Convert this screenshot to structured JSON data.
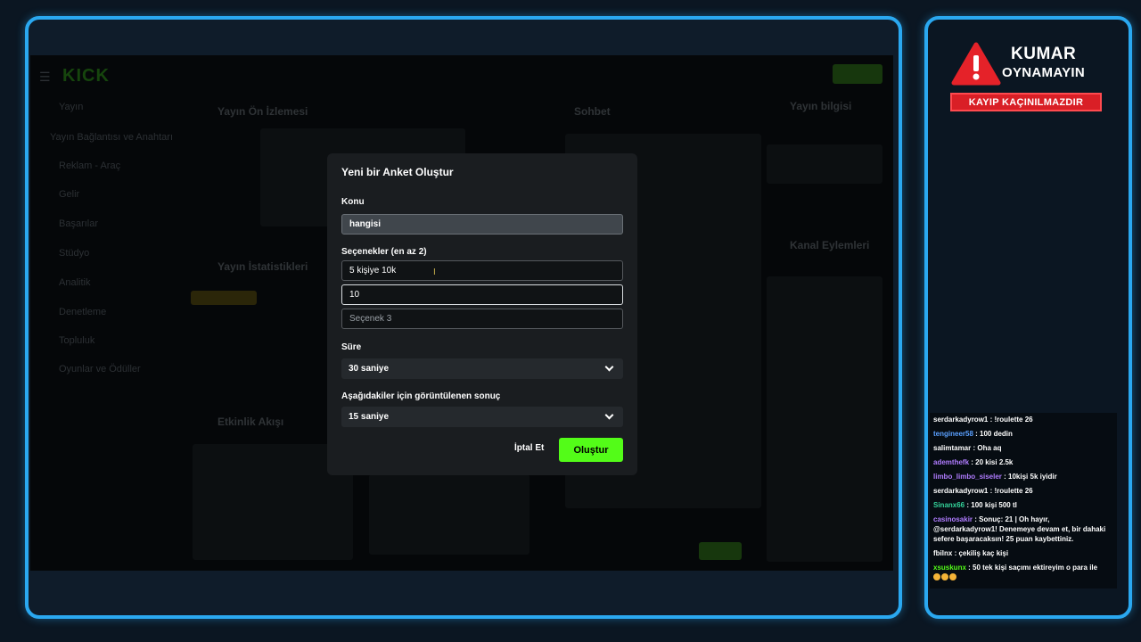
{
  "overlay_brand": {
    "warning_line1": "KUMAR",
    "warning_line2": "OYNAMAYIN",
    "warning_tag": "KAYIP KAÇINILMAZDIR"
  },
  "dashboard": {
    "logo": "KICK",
    "nav": [
      "Yayın",
      "Yayın Bağlantısı ve Anahtarı",
      "Reklam - Araç",
      "Gelir",
      "Başarılar",
      "Stüdyo",
      "Analitik",
      "Denetleme",
      "Topluluk",
      "Oyunlar ve Ödüller"
    ],
    "panels": {
      "preview": "Yayın Ön İzlemesi",
      "stats": "Yayın İstatistikleri",
      "activity": "Etkinlik Akışı",
      "chat": "Sohbet",
      "stream_info": "Yayın bilgisi",
      "channel_actions": "Kanal Eylemleri"
    }
  },
  "modal": {
    "title": "Yeni bir Anket Oluştur",
    "topic_label": "Konu",
    "topic_value": "hangisi",
    "options_label": "Seçenekler (en az 2)",
    "options": [
      {
        "value": "5 kişiye 10k",
        "placeholder": ""
      },
      {
        "value": "10",
        "placeholder": ""
      },
      {
        "value": "",
        "placeholder": "Seçenek 3"
      }
    ],
    "duration_label": "Süre",
    "duration_value": "30 saniye",
    "result_label": "Aşağıdakiler için görüntülenen sonuç",
    "result_value": "15 saniye",
    "cancel_label": "İptal Et",
    "create_label": "Oluştur",
    "create_color": "#53fc18"
  },
  "chat": [
    {
      "user": "serdarkadyrow1",
      "color": "#ffffff",
      "text": ": !roulette 26"
    },
    {
      "user": "tengineer58",
      "color": "#5aa0ff",
      "text": ": 100 dedin"
    },
    {
      "user": "salimtamar",
      "color": "#ffffff",
      "text": ": Oha aq"
    },
    {
      "user": "ademthefk",
      "color": "#b07cff",
      "text": ": 20 kisi 2.5k"
    },
    {
      "user": "limbo_limbo_siseler",
      "color": "#b07cff",
      "text": ": 10kişi 5k iyidir"
    },
    {
      "user": "serdarkadyrow1",
      "color": "#ffffff",
      "text": ": !roulette 26"
    },
    {
      "user": "Sinanx66",
      "color": "#34d39a",
      "text": ": 100 kişi 500 tl"
    },
    {
      "user": "casinosakir",
      "color": "#b07cff",
      "text": ": Sonuç: 21 | Oh hayır, @serdarkadyrow1! Denemeye devam et, bir dahaki sefere başaracaksın! 25 puan kaybettiniz."
    },
    {
      "user": "fbilnx",
      "color": "#ffffff",
      "text": ": çekiliş kaç kişi"
    },
    {
      "user": "xsuskunx",
      "color": "#53fc18",
      "text": ": 50 tek kişi saçımı ektireyim o para ile"
    }
  ]
}
